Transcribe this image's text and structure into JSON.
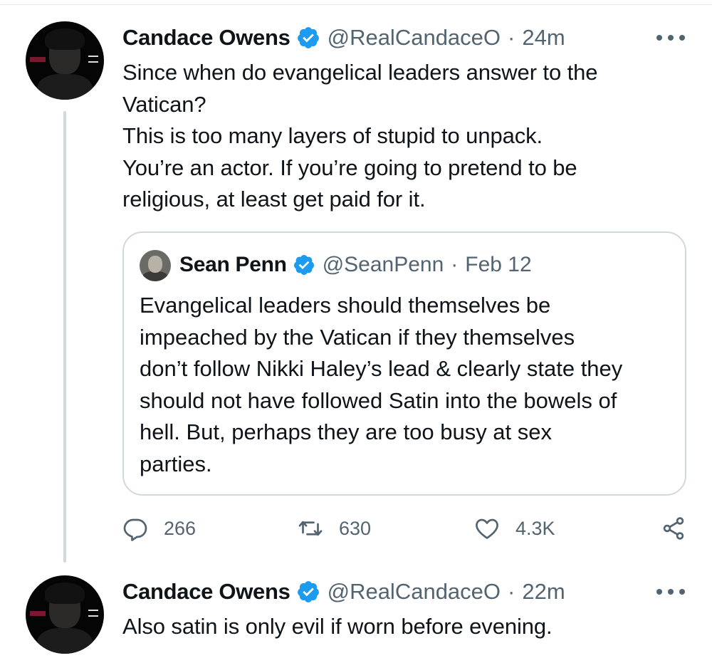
{
  "tweets": [
    {
      "author": "Candace Owens",
      "handle": "@RealCandaceO",
      "separator": "·",
      "time": "24m",
      "text_lines": [
        "Since when do evangelical leaders answer to the",
        "Vatican?",
        "This is too many layers of stupid to unpack.",
        "You’re an actor. If you’re going to pretend to be",
        "religious, at least get paid for it."
      ],
      "quote": {
        "author": "Sean Penn",
        "handle": "@SeanPenn",
        "separator": "·",
        "date": "Feb 12",
        "text_lines": [
          "Evangelical leaders should themselves be",
          "impeached by the Vatican if they themselves",
          "don’t follow Nikki Haley’s lead & clearly state they",
          "should not have followed Satin into the bowels of",
          "hell. But, perhaps they are too busy at sex",
          "parties."
        ]
      },
      "actions": {
        "replies": "266",
        "retweets": "630",
        "likes": "4.3K"
      }
    },
    {
      "author": "Candace Owens",
      "handle": "@RealCandaceO",
      "separator": "·",
      "time": "22m",
      "text_lines": [
        "Also satin is only evil if worn before evening."
      ]
    }
  ],
  "icons": {
    "verified": "verified-badge-icon",
    "more": "more-options-icon",
    "reply": "reply-icon",
    "retweet": "retweet-icon",
    "like": "like-icon",
    "share": "share-icon"
  },
  "colors": {
    "verified": "#1d9bf0",
    "secondary_text": "#536471",
    "border": "#cfd9de"
  }
}
